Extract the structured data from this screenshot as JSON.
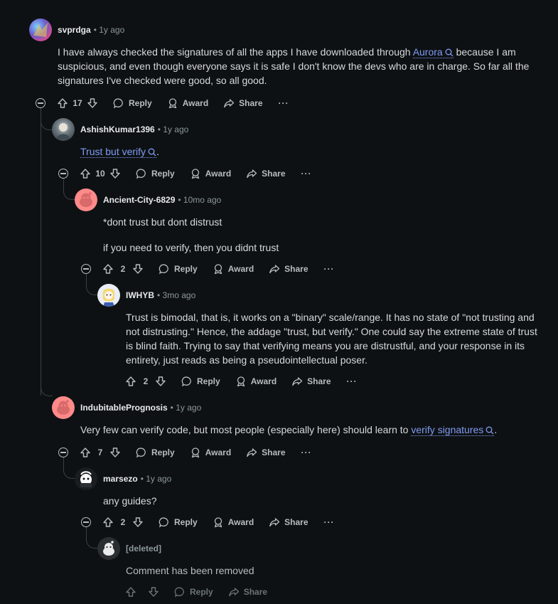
{
  "comments": [
    {
      "user": "svprdga",
      "time": "1y ago",
      "text_before": "I have always checked the signatures of all the apps I have downloaded through",
      "link": "Aurora",
      "text_after": "because I am suspicious, and even though everyone says it is safe I don't know the devs who are in charge. So far all the signatures I've checked were good, so all good.",
      "votes": "17",
      "reply": "Reply",
      "award": "Award",
      "share": "Share",
      "more": "···"
    },
    {
      "user": "AshishKumar1396",
      "time": "1y ago",
      "link": "Trust but verify",
      "text_after": ".",
      "votes": "10",
      "reply": "Reply",
      "award": "Award",
      "share": "Share",
      "more": "···"
    },
    {
      "user": "Ancient-City-6829",
      "time": "10mo ago",
      "line1": "*dont trust but dont distrust",
      "line2": "if you need to verify, then you didnt trust",
      "votes": "2",
      "reply": "Reply",
      "award": "Award",
      "share": "Share",
      "more": "···"
    },
    {
      "user": "IWHYB",
      "time": "3mo ago",
      "text": "Trust is bimodal, that is, it works on a \"binary\" scale/range. It has no state of \"not trusting and not distrusting.\" Hence, the addage \"trust, but verify.\" One could say the extreme state of trust is blind faith. Trying to say that verifying means you are distrustful, and your response in its entirety, just reads as being a pseudointellectual poser.",
      "votes": "2",
      "reply": "Reply",
      "award": "Award",
      "share": "Share",
      "more": "···"
    },
    {
      "user": "IndubitablePrognosis",
      "time": "1y ago",
      "text_before": "Very few can verify code, but most people (especially here) should learn to",
      "link": "verify signatures",
      "text_after": ".",
      "votes": "7",
      "reply": "Reply",
      "award": "Award",
      "share": "Share",
      "more": "···"
    },
    {
      "user": "marsezo",
      "time": "1y ago",
      "text": "any guides?",
      "votes": "2",
      "reply": "Reply",
      "award": "Award",
      "share": "Share",
      "more": "···"
    },
    {
      "user": "[deleted]",
      "text": "Comment has been removed",
      "reply": "Reply",
      "share": "Share"
    }
  ],
  "separator": "•",
  "colors": {
    "background": "#0e1113",
    "link": "#7f9cf5",
    "text": "#d7dadc",
    "muted": "#8b979d"
  }
}
